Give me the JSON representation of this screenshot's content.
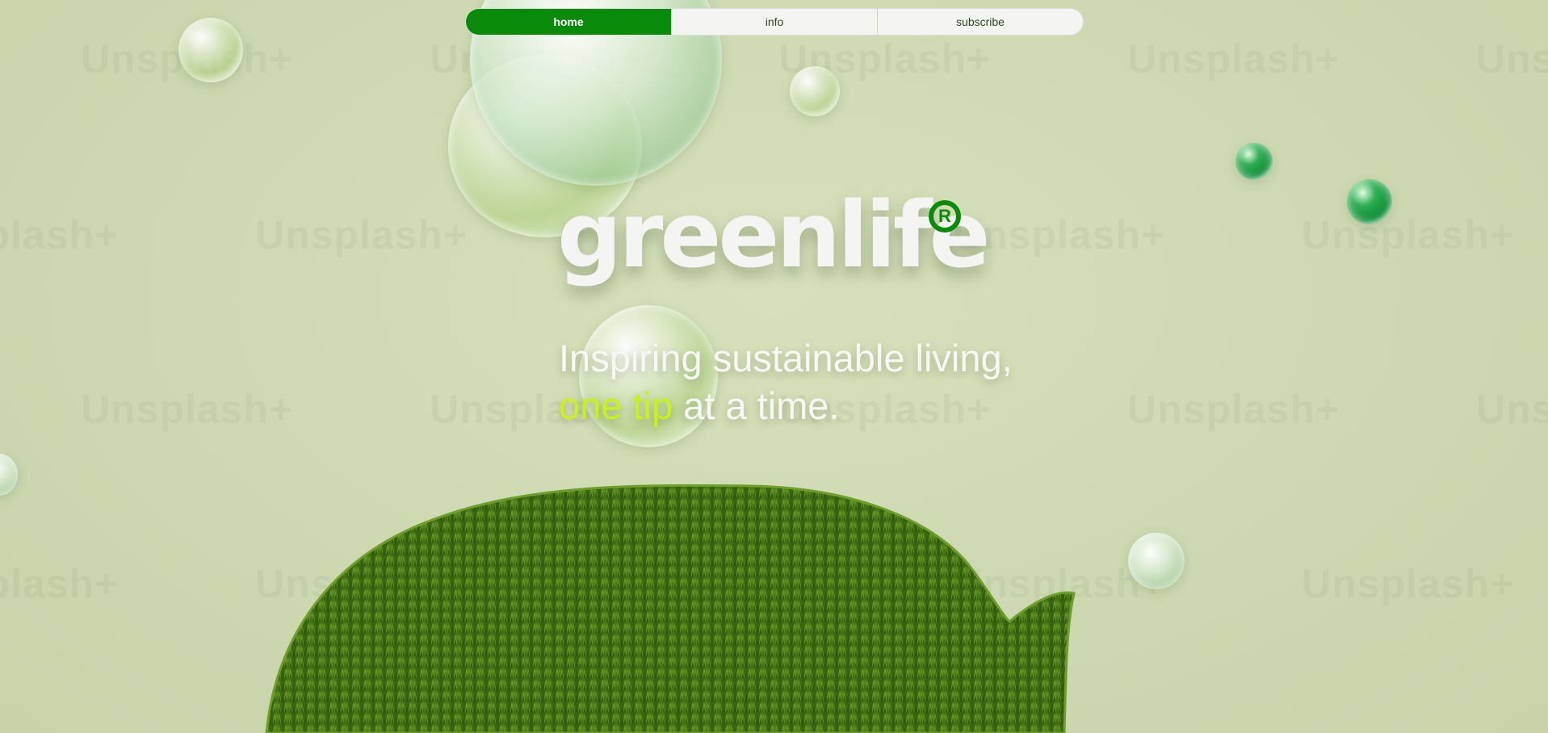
{
  "nav": {
    "items": [
      {
        "label": "home",
        "active": true
      },
      {
        "label": "info",
        "active": false
      },
      {
        "label": "subscribe",
        "active": false
      }
    ]
  },
  "hero": {
    "brand": "greenlife",
    "registered_mark": "R",
    "tagline_line1": "Inspiring sustainable living,",
    "tagline_highlight": "one tip",
    "tagline_line2_rest": " at a time."
  },
  "watermark_text": "Unsplash+",
  "colors": {
    "accent": "#0a8a0a",
    "highlight": "#c9f21a",
    "background": "#cfdab3"
  }
}
